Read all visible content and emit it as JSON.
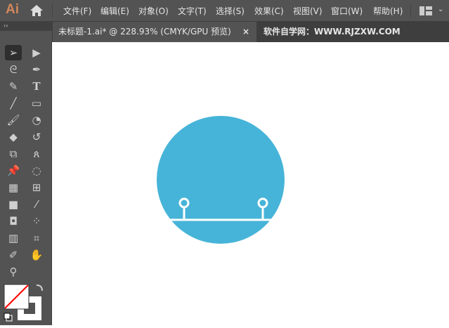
{
  "app": {
    "logo": "Ai"
  },
  "menu": [
    "文件(F)",
    "编辑(E)",
    "对象(O)",
    "文字(T)",
    "选择(S)",
    "效果(C)",
    "视图(V)",
    "窗口(W)",
    "帮助(H)"
  ],
  "panel": {
    "collapse": "‹‹"
  },
  "document_tab": {
    "title": "未标题-1.ai* @ 228.93% (CMYK/GPU 预览)",
    "close": "×"
  },
  "watermark": "软件自学网：WWW.RJZXW.COM",
  "tools": [
    "selection",
    "direct-selection",
    "lasso",
    "pen",
    "curvature",
    "type",
    "line",
    "rectangle",
    "paintbrush",
    "shaper",
    "eraser",
    "rotate",
    "scale",
    "puppet-warp",
    "pin",
    "free-transform",
    "perspective-grid",
    "mesh",
    "gradient",
    "eyedropper",
    "blend",
    "symbol-sprayer",
    "column-graph",
    "artboard",
    "slice",
    "hand",
    "zoom"
  ],
  "colors": {
    "artwork": "#46b4d8",
    "fill": "#ffffff",
    "stroke": "#ffffff",
    "none_slash": "#ff0000"
  }
}
